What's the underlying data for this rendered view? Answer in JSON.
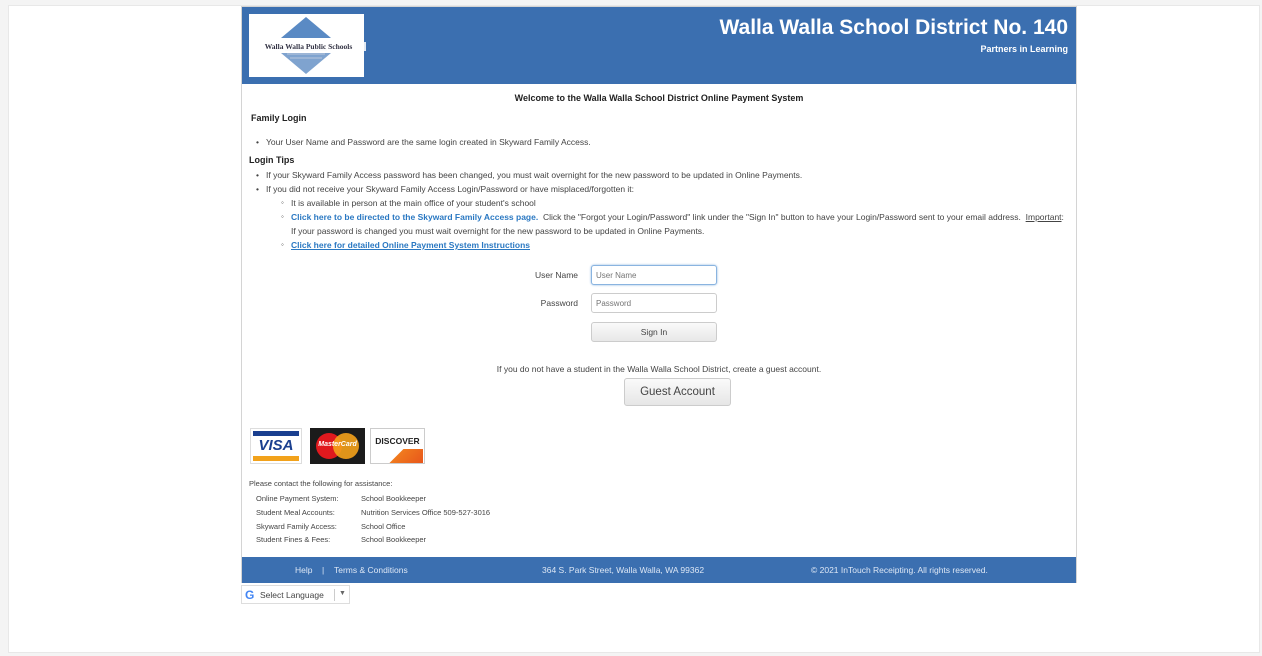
{
  "header": {
    "logo_text": "Walla Walla Public Schools",
    "title": "Walla Walla School District No. 140",
    "tagline": "Partners in Learning"
  },
  "main": {
    "welcome": "Welcome to the Walla Walla School District Online Payment System",
    "family_login_heading": "Family Login",
    "family_login_note": "Your User Name and Password are the same login created in Skyward Family Access.",
    "login_tips_heading": "Login Tips",
    "tip_1": "If your Skyward Family Access password has been changed, you must wait overnight for the new password to be updated in Online Payments.",
    "tip_2": "If you did not receive your Skyward Family Access Login/Password or have misplaced/forgotten it:",
    "sub_1": "It is available in person at the main office of your student's school",
    "sub_2_link": "Click here to be directed to the Skyward Family Access page.",
    "sub_2_text_a": "Click the \"Forgot your Login/Password\" link under the \"Sign In\" button to have your Login/Password sent to your email address.",
    "sub_2_important": "Important",
    "sub_2_text_b": ": If your password is changed you must wait overnight for the new password to be updated in Online Payments.",
    "sub_3_link": "Click here for detailed Online Payment System Instructions"
  },
  "login_form": {
    "username_label": "User Name",
    "username_placeholder": "User Name",
    "password_label": "Password",
    "password_placeholder": "Password",
    "signin_label": "Sign In"
  },
  "guest": {
    "note": "If you do not have a student in the Walla Walla School District, create a guest account.",
    "button_label": "Guest Account"
  },
  "cards": {
    "visa": "VISA",
    "mastercard": "MasterCard",
    "discover": "DISCOVER"
  },
  "contacts": {
    "intro": "Please contact the following for assistance:",
    "rows": [
      {
        "label": "Online Payment System:",
        "value": "School Bookkeeper"
      },
      {
        "label": "Student Meal Accounts:",
        "value": "Nutrition Services Office 509-527-3016"
      },
      {
        "label": "Skyward Family Access:",
        "value": "School Office"
      },
      {
        "label": "Student Fines & Fees:",
        "value": "School Bookkeeper"
      }
    ]
  },
  "footer": {
    "help": "Help",
    "divider": "|",
    "terms": "Terms & Conditions",
    "address": "364 S. Park Street, Walla Walla, WA 99362",
    "copyright": "© 2021 InTouch Receipting. All rights reserved."
  },
  "translate": {
    "label": "Select Language",
    "arrow": "▼"
  },
  "colors": {
    "brand_blue": "#3b6fb0",
    "link_blue": "#2a78c2"
  }
}
